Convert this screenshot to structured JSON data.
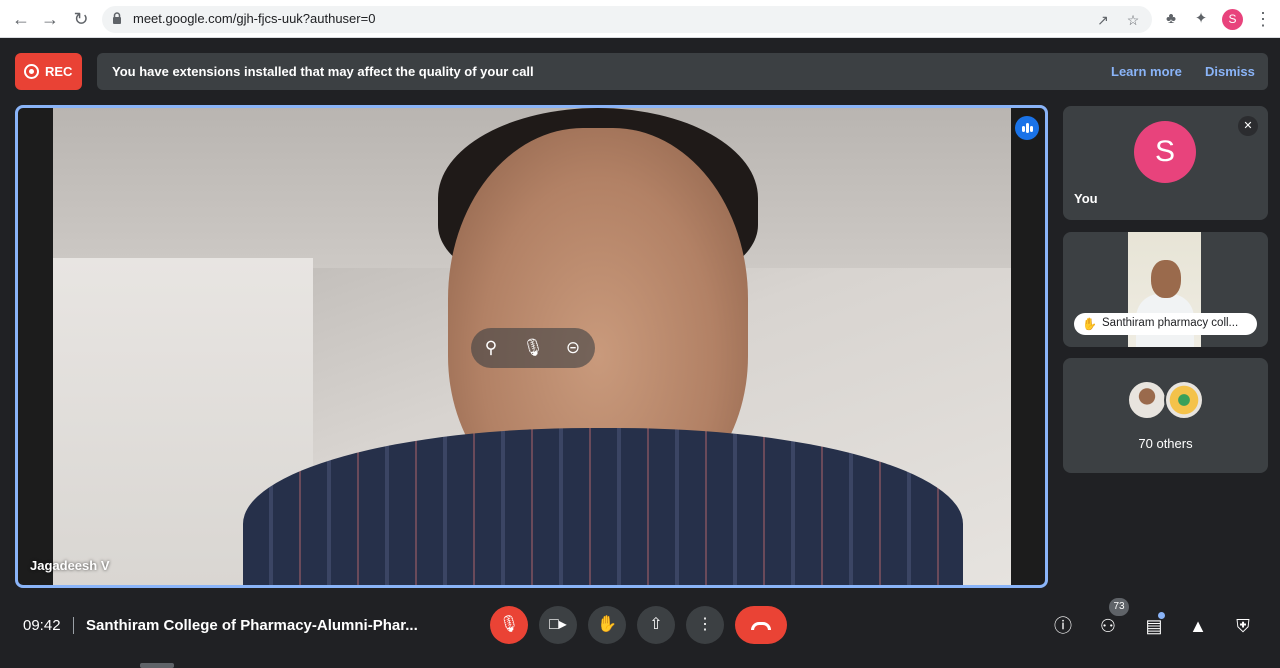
{
  "browser": {
    "url": "meet.google.com/gjh-fjcs-uuk?authuser=0",
    "profile_initial": "S"
  },
  "banner": {
    "rec_label": "REC",
    "message": "You have extensions installed that may affect the quality of your call",
    "learn_more": "Learn more",
    "dismiss": "Dismiss"
  },
  "main_video": {
    "participant_name": "Jagadeesh V"
  },
  "side_tiles": {
    "you": {
      "initial": "S",
      "name": "You"
    },
    "presenter": {
      "name": "Santhiram pharmacy coll..."
    },
    "others": {
      "label": "70 others"
    }
  },
  "bottom_bar": {
    "time": "09:42",
    "meeting_title": "Santhiram College of Pharmacy-Alumni-Phar...",
    "participant_count": "73"
  },
  "colors": {
    "accent_blue": "#8ab4f8",
    "danger_red": "#ea4335",
    "avatar_pink": "#e8437c",
    "surface": "#3c4043",
    "background": "#202124"
  },
  "icons": [
    "back-arrow-icon",
    "forward-arrow-icon",
    "reload-icon",
    "lock-icon",
    "share-icon",
    "star-icon",
    "extension-icon",
    "puzzle-icon",
    "more-vert-icon",
    "speaking-icon",
    "pin-icon",
    "mic-icon",
    "remove-icon",
    "mic-off-icon",
    "camera-icon",
    "raise-hand-icon",
    "present-icon",
    "more-options-icon",
    "end-call-icon",
    "info-icon",
    "people-icon",
    "chat-icon",
    "activities-icon",
    "host-controls-icon"
  ]
}
